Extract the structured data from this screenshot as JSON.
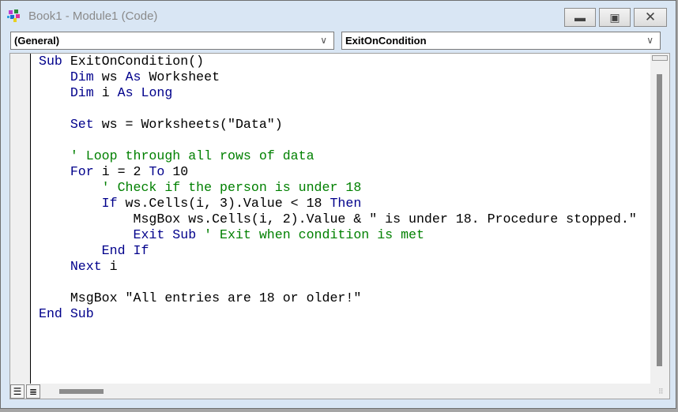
{
  "window": {
    "title": "Book1 - Module1 (Code)",
    "minimize_icon": "minimize-icon",
    "restore_icon": "restore-icon",
    "close_icon": "close-icon"
  },
  "object_combo": {
    "value": "(General)"
  },
  "procedure_combo": {
    "value": "ExitOnCondition"
  },
  "colors": {
    "keyword": "#00008b",
    "comment": "#008000",
    "text": "#000000"
  },
  "code": [
    [
      [
        "kw",
        "Sub "
      ],
      [
        "tx",
        "ExitOnCondition()"
      ]
    ],
    [
      [
        "tx",
        "    "
      ],
      [
        "kw",
        "Dim "
      ],
      [
        "tx",
        "ws "
      ],
      [
        "kw",
        "As "
      ],
      [
        "tx",
        "Worksheet"
      ]
    ],
    [
      [
        "tx",
        "    "
      ],
      [
        "kw",
        "Dim "
      ],
      [
        "tx",
        "i "
      ],
      [
        "kw",
        "As Long"
      ]
    ],
    [],
    [
      [
        "tx",
        "    "
      ],
      [
        "kw",
        "Set "
      ],
      [
        "tx",
        "ws = Worksheets(\"Data\")"
      ]
    ],
    [],
    [
      [
        "cm",
        "    ' Loop through all rows of data"
      ]
    ],
    [
      [
        "tx",
        "    "
      ],
      [
        "kw",
        "For "
      ],
      [
        "tx",
        "i = 2 "
      ],
      [
        "kw",
        "To "
      ],
      [
        "tx",
        "10"
      ]
    ],
    [
      [
        "cm",
        "        ' Check if the person is under 18"
      ]
    ],
    [
      [
        "tx",
        "        "
      ],
      [
        "kw",
        "If "
      ],
      [
        "tx",
        "ws.Cells(i, 3).Value < 18 "
      ],
      [
        "kw",
        "Then"
      ]
    ],
    [
      [
        "tx",
        "            MsgBox ws.Cells(i, 2).Value & \" is under 18. Procedure stopped.\""
      ]
    ],
    [
      [
        "tx",
        "            "
      ],
      [
        "kw",
        "Exit Sub "
      ],
      [
        "cm",
        "' Exit when condition is met"
      ]
    ],
    [
      [
        "tx",
        "        "
      ],
      [
        "kw",
        "End If"
      ]
    ],
    [
      [
        "tx",
        "    "
      ],
      [
        "kw",
        "Next "
      ],
      [
        "tx",
        "i"
      ]
    ],
    [],
    [
      [
        "tx",
        "    MsgBox \"All entries are 18 or older!\""
      ]
    ],
    [
      [
        "kw",
        "End Sub"
      ]
    ]
  ]
}
